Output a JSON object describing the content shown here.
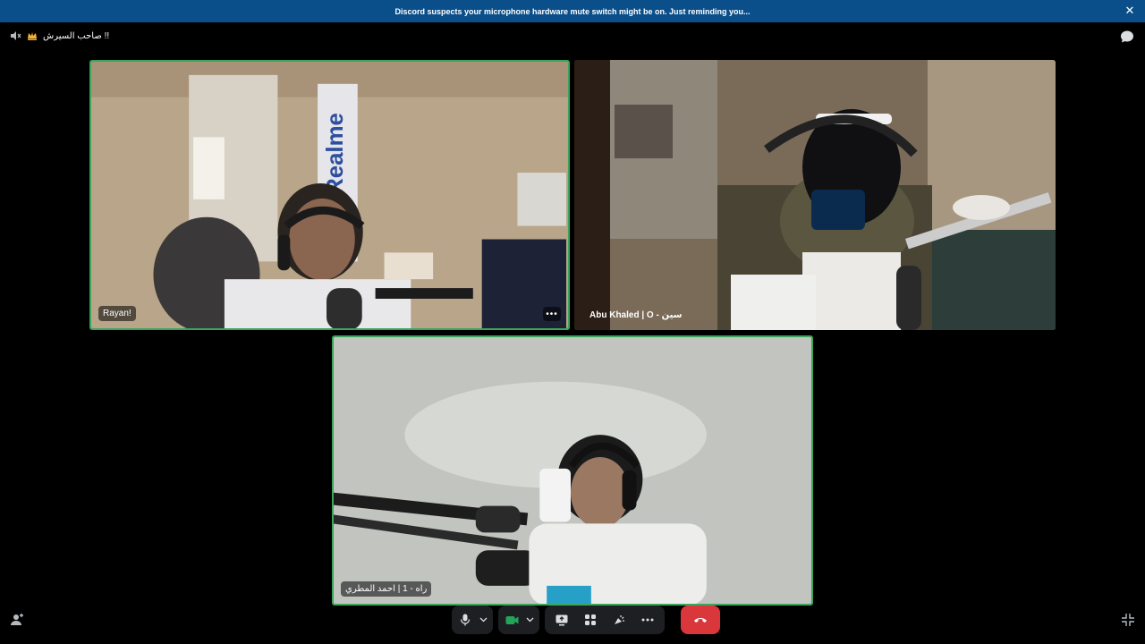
{
  "banner": {
    "text": "Discord suspects your microphone hardware mute switch might be on. Just reminding you...",
    "close_icon": "close-icon"
  },
  "channel": {
    "name": "صاحب السيرش !!",
    "crown_icon": "crown-icon",
    "speaker_icon": "speaker-muted-icon"
  },
  "participants": [
    {
      "name": "Rayan!",
      "speaking": true
    },
    {
      "name": "Abu Khaled | O - سين",
      "speaking": false
    },
    {
      "name": "راه - 1 | احمد المطري",
      "speaking": true
    }
  ],
  "controls": {
    "mic_icon": "microphone-icon",
    "camera_icon": "camera-icon",
    "screenshare_icon": "screen-share-icon",
    "activities_icon": "activities-icon",
    "soundboard_icon": "soundboard-icon",
    "more_icon": "more-icon",
    "end_call_icon": "hang-up-icon"
  },
  "colors": {
    "banner": "#0b4f8a",
    "speaking_border": "#3ba55c",
    "end_call": "#da373c",
    "camera_active": "#23a55a"
  }
}
